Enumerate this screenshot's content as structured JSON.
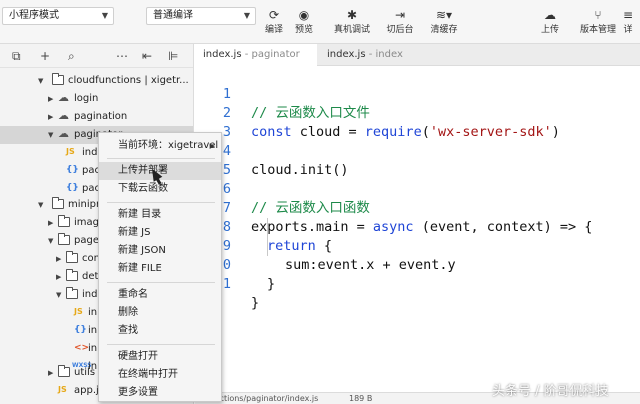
{
  "toolbar": {
    "mode_select": "小程序模式",
    "compile_select": "普通编译",
    "compile": "编译",
    "preview": "预览",
    "remote_debug": "真机调试",
    "background": "切后台",
    "clear_cache": "清缓存",
    "upload": "上传",
    "version_mgmt": "版本管理",
    "details_partial": "详"
  },
  "explorer": {
    "items": [
      {
        "label": "cloudfunctions | xigetr..."
      },
      {
        "label": "login"
      },
      {
        "label": "pagination"
      },
      {
        "label": "paginator"
      },
      {
        "label": "inde"
      },
      {
        "label": "pacl"
      },
      {
        "label": "pacl"
      },
      {
        "label": "miniprog"
      },
      {
        "label": "image"
      },
      {
        "label": "pages"
      },
      {
        "label": "com"
      },
      {
        "label": "deta"
      },
      {
        "label": "inde"
      },
      {
        "label": "in"
      },
      {
        "label": "in"
      },
      {
        "label": "in"
      },
      {
        "label": "in"
      },
      {
        "label": "utils"
      },
      {
        "label": "app.js"
      }
    ]
  },
  "tabs": [
    {
      "name": "index.js",
      "sub": " - paginator"
    },
    {
      "name": "index.js",
      "sub": " - index"
    }
  ],
  "editor": {
    "line_numbers": [
      "1",
      "2",
      "3",
      "4",
      "5",
      "6",
      "7",
      "8",
      "9",
      "0",
      "1"
    ],
    "l1": "// 云函数入口文件",
    "l2_kw": "const",
    "l2_a": " cloud = ",
    "l2_fn": "require",
    "l2_b": "(",
    "l2_str": "'wx-server-sdk'",
    "l2_c": ")",
    "l4": "cloud.init()",
    "l6": "// 云函数入口函数",
    "l7_a": "exports.main = ",
    "l7_kw": "async",
    "l7_b": " (event, context) => {",
    "l8_kw": "return",
    "l8_b": " {",
    "l9": "sum:event.x + event.y",
    "l10": "}",
    "l11": "}"
  },
  "statusbar": {
    "path": "...functions/paginator/index.js",
    "size": "189 B"
  },
  "context_menu": {
    "current_env": "当前环境：xigetravel",
    "upload_deploy": "上传并部署",
    "download": "下载云函数",
    "new_dir": "新建 目录",
    "new_js": "新建 JS",
    "new_json": "新建 JSON",
    "new_file": "新建 FILE",
    "rename": "重命名",
    "delete": "删除",
    "find": "查找",
    "open_disk": "硬盘打开",
    "open_terminal": "在终端中打开",
    "more_settings": "更多设置"
  },
  "watermark": "头条号 / 阶哥侃科技"
}
